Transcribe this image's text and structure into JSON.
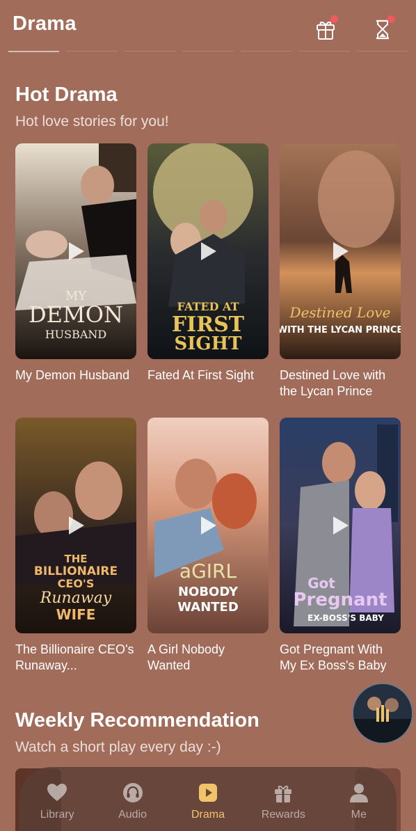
{
  "header": {
    "title": "Drama",
    "gift_icon": "gift-icon",
    "hourglass_icon": "hourglass-icon"
  },
  "hot_drama": {
    "title": "Hot Drama",
    "subtitle": "Hot love stories for you!",
    "items": [
      {
        "title": "My Demon Husband",
        "cover_text": [
          "MY",
          "DEMON",
          "HUSBAND"
        ]
      },
      {
        "title": "Fated At First Sight",
        "cover_text": [
          "FATED AT",
          "FIRST",
          "SIGHT"
        ]
      },
      {
        "title": "Destined Love with the Lycan Prince",
        "cover_text": [
          "Destined Love",
          "WITH THE LYCAN PRINCE"
        ]
      },
      {
        "title": "The Billionaire CEO's Runaway...",
        "cover_text": [
          "THE",
          "BILLIONAIRE",
          "CEO'S",
          "Runaway",
          "WIFE"
        ]
      },
      {
        "title": "A Girl Nobody Wanted",
        "cover_text": [
          "aGIRL",
          "NOBODY",
          "WANTED"
        ]
      },
      {
        "title": "Got Pregnant With My Ex Boss's Baby",
        "cover_text": [
          "Got",
          "Pregnant",
          "EX-BOSS'S BABY"
        ]
      }
    ]
  },
  "weekly": {
    "title": "Weekly Recommendation",
    "subtitle": "Watch a short play every day :-)"
  },
  "nav": {
    "items": [
      {
        "label": "Library",
        "icon": "heart-icon"
      },
      {
        "label": "Audio",
        "icon": "headphones-icon"
      },
      {
        "label": "Drama",
        "icon": "play-icon",
        "active": true
      },
      {
        "label": "Rewards",
        "icon": "gift-box-icon"
      },
      {
        "label": "Me",
        "icon": "person-icon"
      }
    ]
  },
  "colors": {
    "background": "#a26c5a",
    "accent": "#f2c46a",
    "badge": "#f2595d"
  }
}
